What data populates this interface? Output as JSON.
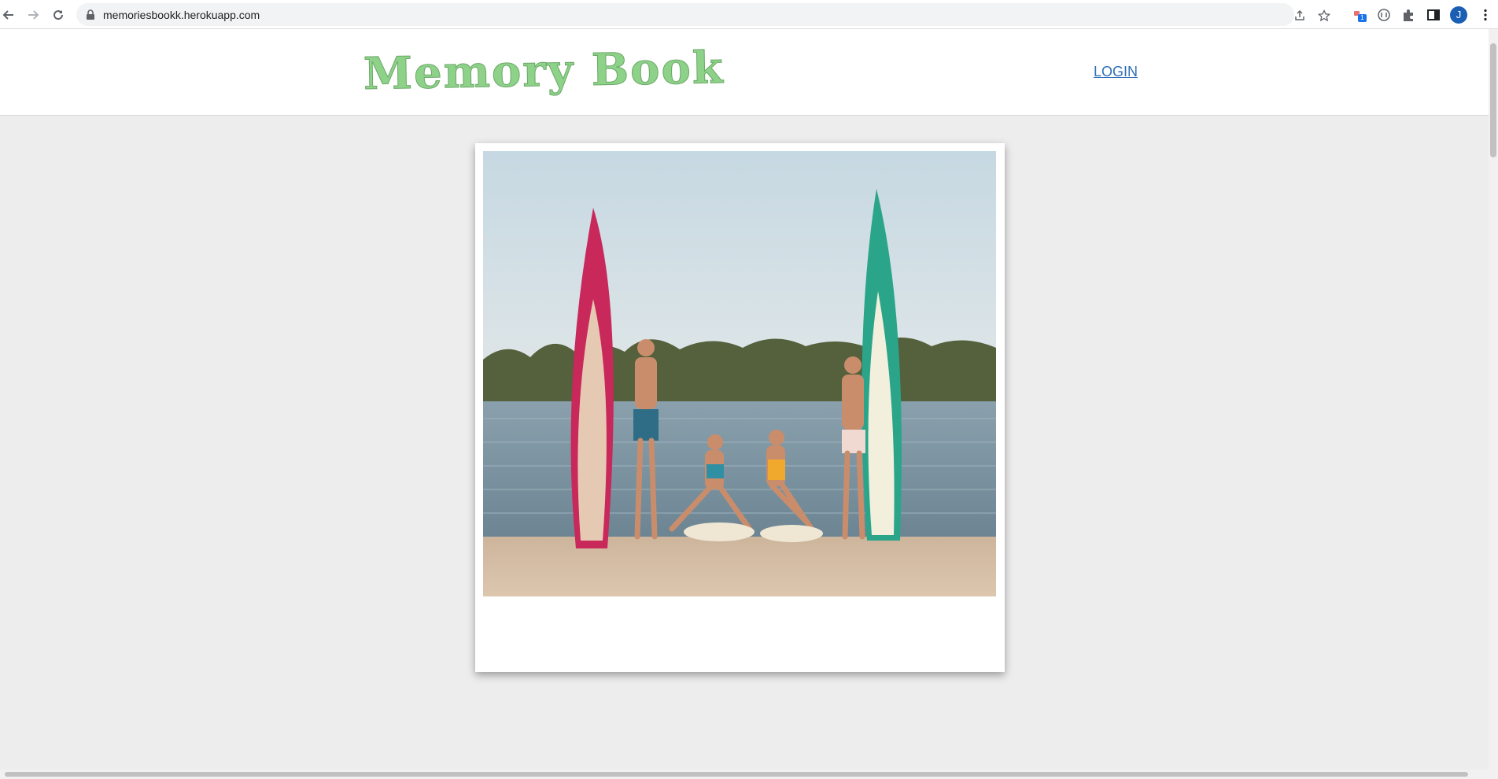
{
  "browser": {
    "url": "memoriesbookk.herokuapp.com",
    "profile_initial": "J",
    "extension_badge": "1",
    "icons": [
      "back-arrow-icon",
      "forward-arrow-icon",
      "reload-icon",
      "lock-icon",
      "share-icon",
      "star-icon",
      "extension-icon",
      "shield-icon",
      "puzzle-icon",
      "side-panel-icon",
      "kebab-menu-icon"
    ]
  },
  "header": {
    "logo_text": "Memory Book",
    "login_label": "LOGIN",
    "logo_color": "#8ed28a",
    "link_color": "#2f6fb5"
  },
  "main": {
    "background": "#ededed",
    "polaroid_caption": ""
  }
}
